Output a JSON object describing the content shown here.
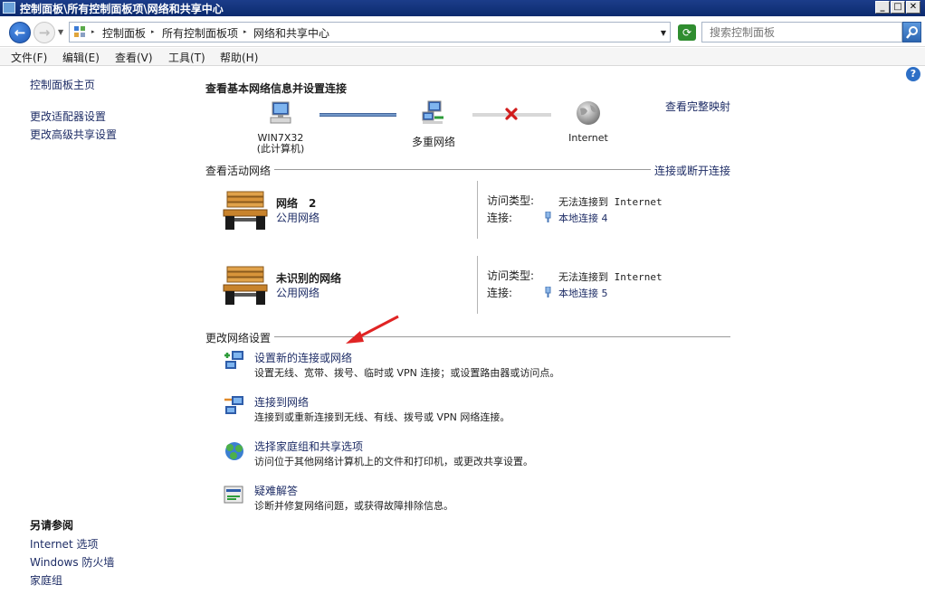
{
  "window": {
    "title": "控制面板\\所有控制面板项\\网络和共享中心"
  },
  "address": {
    "crumbs": [
      "控制面板",
      "所有控制面板项",
      "网络和共享中心"
    ],
    "search_placeholder": "搜索控制面板"
  },
  "menu": [
    "文件(F)",
    "编辑(E)",
    "查看(V)",
    "工具(T)",
    "帮助(H)"
  ],
  "left": {
    "home": "控制面板主页",
    "links": [
      "更改适配器设置",
      "更改高级共享设置"
    ],
    "seealso_title": "另请参阅",
    "seealso": [
      "Internet 选项",
      "Windows 防火墙",
      "家庭组"
    ]
  },
  "main": {
    "heading": "查看基本网络信息并设置连接",
    "full_map": "查看完整映射",
    "map": {
      "computer_name": "WIN7X32",
      "computer_sub": "(此计算机)",
      "multi": "多重网络",
      "internet": "Internet"
    },
    "active_title": "查看活动网络",
    "connect_link": "连接或断开连接",
    "networks": [
      {
        "name": "网络　2",
        "category": "公用网络",
        "access_label": "访问类型:",
        "access_value": "无法连接到 Internet",
        "conn_label": "连接:",
        "conn_value": "本地连接 4"
      },
      {
        "name": "未识别的网络",
        "category": "公用网络",
        "access_label": "访问类型:",
        "access_value": "无法连接到 Internet",
        "conn_label": "连接:",
        "conn_value": "本地连接 5"
      }
    ],
    "change_title": "更改网络设置",
    "tasks": [
      {
        "title": "设置新的连接或网络",
        "desc": "设置无线、宽带、拨号、临时或 VPN 连接；或设置路由器或访问点。"
      },
      {
        "title": "连接到网络",
        "desc": "连接到或重新连接到无线、有线、拨号或 VPN 网络连接。"
      },
      {
        "title": "选择家庭组和共享选项",
        "desc": "访问位于其他网络计算机上的文件和打印机，或更改共享设置。"
      },
      {
        "title": "疑难解答",
        "desc": "诊断并修复网络问题，或获得故障排除信息。"
      }
    ]
  },
  "colors": {
    "link": "#1e2d66",
    "titlebar": "#0b2a6e"
  }
}
